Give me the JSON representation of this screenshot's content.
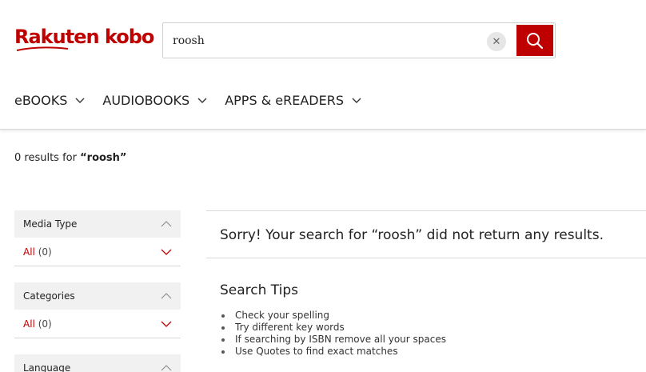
{
  "header": {
    "logo_text": "Rakuten kobo",
    "brand_color": "#bf0000",
    "search": {
      "value": "roosh",
      "placeholder": ""
    },
    "clear_icon": "close-icon",
    "search_icon": "search-icon"
  },
  "nav": {
    "items": [
      {
        "label": "eBOOKS"
      },
      {
        "label": "AUDIOBOOKS"
      },
      {
        "label": "APPS & eREADERS"
      }
    ]
  },
  "results": {
    "count_prefix": "0 results for ",
    "query_quoted": "“roosh”"
  },
  "sidebar": {
    "facets": [
      {
        "title": "Media Type",
        "all_label": "All",
        "count": "(0)"
      },
      {
        "title": "Categories",
        "all_label": "All",
        "count": "(0)"
      },
      {
        "title": "Language"
      }
    ]
  },
  "main": {
    "sorry_message": "Sorry! Your search for “roosh” did not return any results.",
    "tips_title": "Search Tips",
    "tips": [
      "Check your spelling",
      "Try different key words",
      "If searching by ISBN remove all your spaces",
      "Use Quotes to find exact matches"
    ]
  }
}
